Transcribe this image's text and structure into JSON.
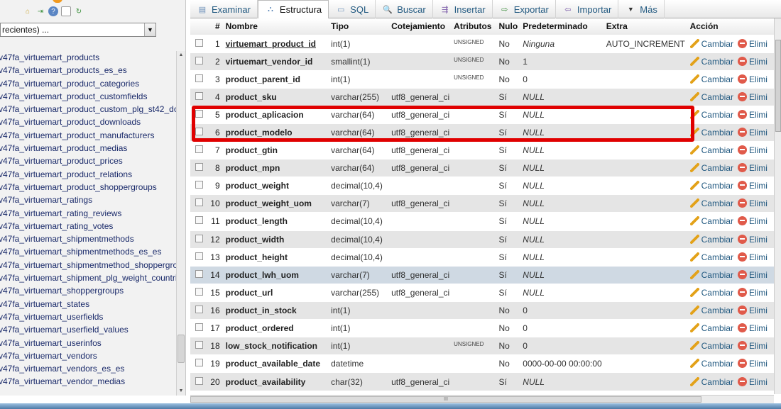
{
  "nav": {
    "db_select": "recientes) ...",
    "tables": [
      "v47fa_virtuemart_products",
      "v47fa_virtuemart_products_es_es",
      "v47fa_virtuemart_product_categories",
      "v47fa_virtuemart_product_customfields",
      "v47fa_virtuemart_product_custom_plg_st42_dc",
      "v47fa_virtuemart_product_downloads",
      "v47fa_virtuemart_product_manufacturers",
      "v47fa_virtuemart_product_medias",
      "v47fa_virtuemart_product_prices",
      "v47fa_virtuemart_product_relations",
      "v47fa_virtuemart_product_shoppergroups",
      "v47fa_virtuemart_ratings",
      "v47fa_virtuemart_rating_reviews",
      "v47fa_virtuemart_rating_votes",
      "v47fa_virtuemart_shipmentmethods",
      "v47fa_virtuemart_shipmentmethods_es_es",
      "v47fa_virtuemart_shipmentmethod_shoppergro",
      "v47fa_virtuemart_shipment_plg_weight_countri",
      "v47fa_virtuemart_shoppergroups",
      "v47fa_virtuemart_states",
      "v47fa_virtuemart_userfields",
      "v47fa_virtuemart_userfield_values",
      "v47fa_virtuemart_userinfos",
      "v47fa_virtuemart_vendors",
      "v47fa_virtuemart_vendors_es_es",
      "v47fa_virtuemart_vendor_medias"
    ]
  },
  "tabs": [
    {
      "label": "Examinar",
      "icon": "browse-icon"
    },
    {
      "label": "Estructura",
      "icon": "structure-icon",
      "active": true
    },
    {
      "label": "SQL",
      "icon": "sql-icon"
    },
    {
      "label": "Buscar",
      "icon": "search-icon"
    },
    {
      "label": "Insertar",
      "icon": "insert-icon"
    },
    {
      "label": "Exportar",
      "icon": "export-icon"
    },
    {
      "label": "Importar",
      "icon": "import-icon"
    },
    {
      "label": "Más",
      "icon": "dropdown-icon"
    }
  ],
  "columns": [
    "#",
    "Nombre",
    "Tipo",
    "Cotejamiento",
    "Atributos",
    "Nulo",
    "Predeterminado",
    "Extra",
    "Acción"
  ],
  "actions": {
    "edit": "Cambiar",
    "delete": "Elimi"
  },
  "rows": [
    {
      "n": "1",
      "name": "virtuemart_product_id",
      "type": "int(1)",
      "coll": "",
      "attr": "UNSIGNED",
      "null": "No",
      "def": "Ninguna",
      "extra": "AUTO_INCREMENT",
      "pk": true
    },
    {
      "n": "2",
      "name": "virtuemart_vendor_id",
      "type": "smallint(1)",
      "coll": "",
      "attr": "UNSIGNED",
      "null": "No",
      "def": "1",
      "extra": ""
    },
    {
      "n": "3",
      "name": "product_parent_id",
      "type": "int(1)",
      "coll": "",
      "attr": "UNSIGNED",
      "null": "No",
      "def": "0",
      "extra": ""
    },
    {
      "n": "4",
      "name": "product_sku",
      "type": "varchar(255)",
      "coll": "utf8_general_ci",
      "attr": "",
      "null": "Sí",
      "def": "NULL",
      "extra": ""
    },
    {
      "n": "5",
      "name": "product_aplicacion",
      "type": "varchar(64)",
      "coll": "utf8_general_ci",
      "attr": "",
      "null": "Sí",
      "def": "NULL",
      "extra": ""
    },
    {
      "n": "6",
      "name": "product_modelo",
      "type": "varchar(64)",
      "coll": "utf8_general_ci",
      "attr": "",
      "null": "Sí",
      "def": "NULL",
      "extra": ""
    },
    {
      "n": "7",
      "name": "product_gtin",
      "type": "varchar(64)",
      "coll": "utf8_general_ci",
      "attr": "",
      "null": "Sí",
      "def": "NULL",
      "extra": ""
    },
    {
      "n": "8",
      "name": "product_mpn",
      "type": "varchar(64)",
      "coll": "utf8_general_ci",
      "attr": "",
      "null": "Sí",
      "def": "NULL",
      "extra": ""
    },
    {
      "n": "9",
      "name": "product_weight",
      "type": "decimal(10,4)",
      "coll": "",
      "attr": "",
      "null": "Sí",
      "def": "NULL",
      "extra": ""
    },
    {
      "n": "10",
      "name": "product_weight_uom",
      "type": "varchar(7)",
      "coll": "utf8_general_ci",
      "attr": "",
      "null": "Sí",
      "def": "NULL",
      "extra": ""
    },
    {
      "n": "11",
      "name": "product_length",
      "type": "decimal(10,4)",
      "coll": "",
      "attr": "",
      "null": "Sí",
      "def": "NULL",
      "extra": ""
    },
    {
      "n": "12",
      "name": "product_width",
      "type": "decimal(10,4)",
      "coll": "",
      "attr": "",
      "null": "Sí",
      "def": "NULL",
      "extra": ""
    },
    {
      "n": "13",
      "name": "product_height",
      "type": "decimal(10,4)",
      "coll": "",
      "attr": "",
      "null": "Sí",
      "def": "NULL",
      "extra": ""
    },
    {
      "n": "14",
      "name": "product_lwh_uom",
      "type": "varchar(7)",
      "coll": "utf8_general_ci",
      "attr": "",
      "null": "Sí",
      "def": "NULL",
      "extra": "",
      "hl": true
    },
    {
      "n": "15",
      "name": "product_url",
      "type": "varchar(255)",
      "coll": "utf8_general_ci",
      "attr": "",
      "null": "Sí",
      "def": "NULL",
      "extra": ""
    },
    {
      "n": "16",
      "name": "product_in_stock",
      "type": "int(1)",
      "coll": "",
      "attr": "",
      "null": "No",
      "def": "0",
      "extra": ""
    },
    {
      "n": "17",
      "name": "product_ordered",
      "type": "int(1)",
      "coll": "",
      "attr": "",
      "null": "No",
      "def": "0",
      "extra": ""
    },
    {
      "n": "18",
      "name": "low_stock_notification",
      "type": "int(1)",
      "coll": "",
      "attr": "UNSIGNED",
      "null": "No",
      "def": "0",
      "extra": ""
    },
    {
      "n": "19",
      "name": "product_available_date",
      "type": "datetime",
      "coll": "",
      "attr": "",
      "null": "No",
      "def": "0000-00-00 00:00:00",
      "extra": ""
    },
    {
      "n": "20",
      "name": "product_availability",
      "type": "char(32)",
      "coll": "utf8_general_ci",
      "attr": "",
      "null": "Sí",
      "def": "NULL",
      "extra": ""
    }
  ],
  "colors": {
    "link": "#235a81",
    "highlight_box": "#e00000",
    "row_alt": "#e5e5e5",
    "row_hover": "#cfd9e3"
  }
}
